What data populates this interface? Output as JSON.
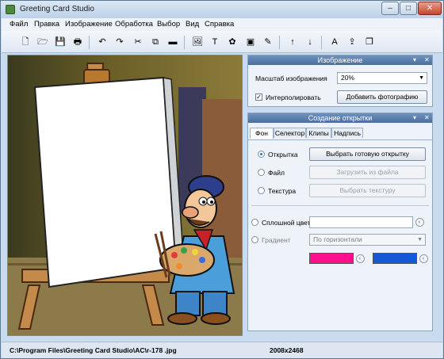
{
  "window": {
    "title": "Greeting Card Studio",
    "min_label": "–",
    "max_label": "□",
    "close_label": "✕"
  },
  "menu": {
    "items": [
      "Файл",
      "Правка",
      "Изображение",
      "Обработка",
      "Выбор",
      "Вид",
      "Справка"
    ]
  },
  "toolbar": {
    "icons": [
      "new-file-icon",
      "open-folder-icon",
      "save-icon",
      "print-icon",
      "undo-icon",
      "redo-icon",
      "cut-icon",
      "copy-icon",
      "paste-icon",
      "insert-image-icon",
      "insert-text-icon",
      "insert-clipart-icon",
      "insert-frame-icon",
      "effects-icon",
      "bring-forward-icon",
      "send-backward-icon",
      "text-effect-icon",
      "export-icon",
      "preview-icon"
    ],
    "glyphs": [
      "🗋",
      "🗁",
      "💾",
      "🖶",
      "↶",
      "↷",
      "✂",
      "⧉",
      "▬",
      "🖼",
      "T",
      "✿",
      "▣",
      "✎",
      "↑",
      "↓",
      "A",
      "⇪",
      "❐"
    ]
  },
  "image_panel": {
    "header": "Изображение",
    "scale_label": "Масштаб изображения",
    "scale_value": "20%",
    "interpolate_label": "Интерполировать",
    "interpolate_checked": "✓",
    "add_photo_button": "Добавить фотографию"
  },
  "card_panel": {
    "header": "Создание открытки",
    "tabs": [
      "Фон",
      "Селектор",
      "Клипы",
      "Надпись"
    ],
    "postcard_label": "Открытка",
    "postcard_button": "Выбрать готовую открытку",
    "file_label": "Файл",
    "file_button": "Загрузить из файла",
    "texture_label": "Текстура",
    "texture_button": "Выбрать текстуру",
    "solid_color_label": "Сплошной цвет",
    "gradient_label": "Градиент",
    "gradient_value": "По горизонтали",
    "gradient_color1": "#ff0f8c",
    "gradient_color2": "#1458d8"
  },
  "status": {
    "path": "C:\\Program Files\\Greeting Card Studio\\AC\\r-178 .jpg",
    "dimensions": "2008x2468"
  },
  "panel_ctrl": {
    "dropdown": "▾",
    "close": "✕"
  }
}
